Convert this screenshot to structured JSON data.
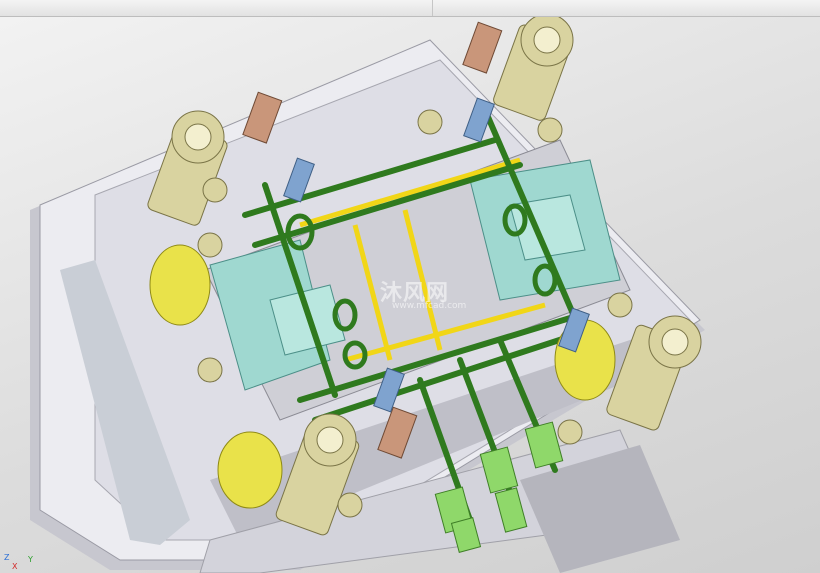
{
  "app": {
    "name": "CAD mold assembly viewport",
    "accent": "#2b6fd6"
  },
  "toolbar": {
    "sections": 2
  },
  "viewport": {
    "background": "#dcdcdc",
    "watermark": "沐风网",
    "watermark_url": "www.mfcad.com"
  },
  "triad": {
    "z_label": "Z",
    "y_label": "Y",
    "x_label": "X"
  },
  "colors": {
    "plate": "#e9e9ee",
    "plate_shadow": "#b9b9c2",
    "bushing": "#d9d3a0",
    "spring": "#e9e24a",
    "slider": "#9fd8d0",
    "cooling": "#2f7a1e",
    "hot_runner": "#f1d617",
    "fitting": "#8fd86a",
    "bolt_blue": "#7fa3cf",
    "bolt_copper": "#c9967a"
  }
}
